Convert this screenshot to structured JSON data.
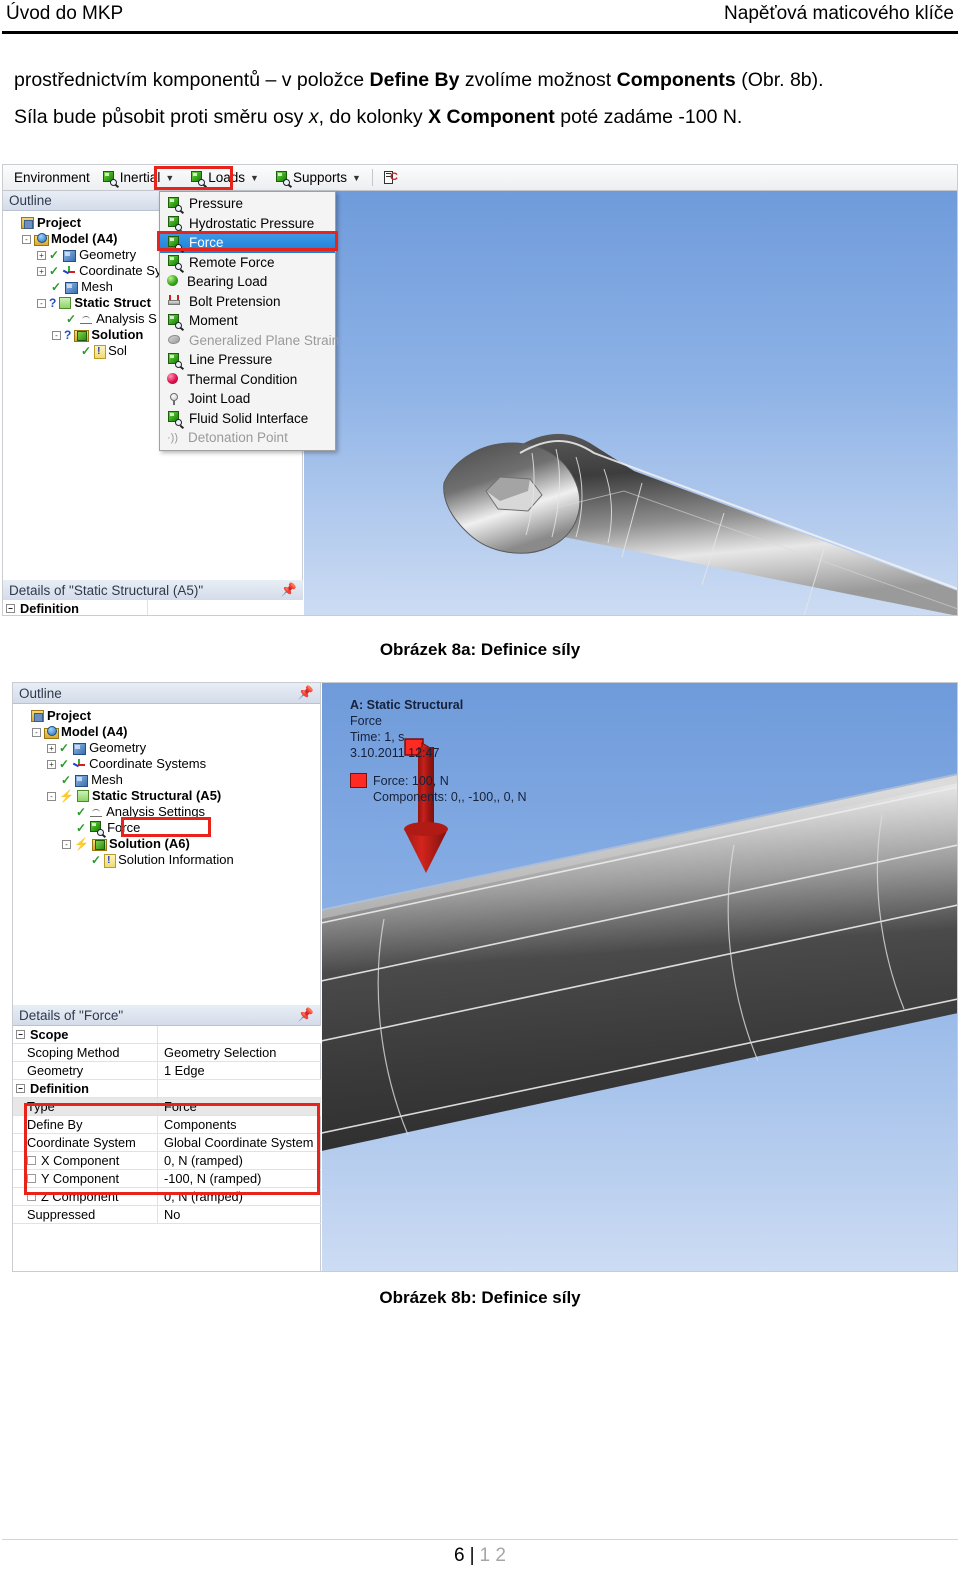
{
  "header": {
    "left": "Úvod do MKP",
    "right": "Napěťová maticového klíče"
  },
  "body": {
    "para1_a": "prostřednictvím komponentů – v položce ",
    "para1_b1": "Define By",
    "para1_c": " zvolíme možnost ",
    "para1_b2": "Components",
    "para1_d": " (Obr. 8b).",
    "para2_a": "Síla bude působit proti směru osy ",
    "para2_i": "x",
    "para2_b": ", do kolonky ",
    "para2_b1": "X Component",
    "para2_c": " poté zadáme -100 N."
  },
  "figure_a": {
    "caption": "Obrázek 8a: Definice síly",
    "toolbar": {
      "environment": "Environment",
      "inertial": "Inertial",
      "loads": "Loads",
      "supports": "Supports"
    },
    "outline_title": "Outline",
    "tree": [
      {
        "label": "Project",
        "bold": true,
        "indent": 0,
        "icon": "project-folder-icon",
        "expander": "",
        "mark": ""
      },
      {
        "label": "Model (A4)",
        "bold": true,
        "indent": 1,
        "icon": "model-icon",
        "expander": "-",
        "mark": ""
      },
      {
        "label": "Geometry",
        "bold": false,
        "indent": 2,
        "icon": "geometry-icon",
        "expander": "+",
        "mark": "check"
      },
      {
        "label": "Coordinate Sys",
        "bold": false,
        "indent": 2,
        "icon": "coordinate-system-icon",
        "expander": "+",
        "mark": "check"
      },
      {
        "label": "Mesh",
        "bold": false,
        "indent": 2,
        "icon": "mesh-icon",
        "expander": "",
        "mark": "check"
      },
      {
        "label": "Static Struct",
        "bold": true,
        "indent": 2,
        "icon": "static-structural-icon",
        "expander": "-",
        "mark": "question"
      },
      {
        "label": "Analysis S",
        "bold": false,
        "indent": 3,
        "icon": "analysis-settings-icon",
        "expander": "",
        "mark": "check"
      },
      {
        "label": "Solution",
        "bold": true,
        "indent": 3,
        "icon": "solution-icon",
        "expander": "-",
        "mark": "question"
      },
      {
        "label": "Sol",
        "bold": false,
        "indent": 4,
        "icon": "solution-information-icon",
        "expander": "",
        "mark": "check"
      }
    ],
    "menu_items": [
      {
        "label": "Pressure",
        "icon": "green-cube-icon",
        "state": "normal"
      },
      {
        "label": "Hydrostatic Pressure",
        "icon": "green-cube-icon",
        "state": "normal"
      },
      {
        "label": "Force",
        "icon": "green-cube-icon",
        "state": "selected"
      },
      {
        "label": "Remote Force",
        "icon": "green-cube-icon",
        "state": "normal"
      },
      {
        "label": "Bearing Load",
        "icon": "green-sphere-icon",
        "state": "normal"
      },
      {
        "label": "Bolt Pretension",
        "icon": "bolt-pretension-icon",
        "state": "normal"
      },
      {
        "label": "Moment",
        "icon": "green-cube-icon",
        "state": "normal"
      },
      {
        "label": "Generalized Plane Strain",
        "icon": "grey-bean-icon",
        "state": "disabled"
      },
      {
        "label": "Line Pressure",
        "icon": "green-cube-icon",
        "state": "normal"
      },
      {
        "label": "Thermal Condition",
        "icon": "red-sphere-icon",
        "state": "normal"
      },
      {
        "label": "Joint Load",
        "icon": "joint-icon",
        "state": "normal"
      },
      {
        "label": "Fluid Solid Interface",
        "icon": "green-cube-icon",
        "state": "normal"
      },
      {
        "label": "Detonation Point",
        "icon": "detonation-icon",
        "state": "disabled"
      }
    ],
    "details_title": "Details of \"Static Structural (A5)\"",
    "details_rows": [
      {
        "label": "Definition",
        "value": "",
        "header": true
      }
    ]
  },
  "figure_b": {
    "caption": "Obrázek 8b: Definice síly",
    "outline_title": "Outline",
    "tree": [
      {
        "label": "Project",
        "bold": true,
        "indent": 0,
        "icon": "project-folder-icon",
        "expander": "",
        "mark": ""
      },
      {
        "label": "Model (A4)",
        "bold": true,
        "indent": 1,
        "icon": "model-icon",
        "expander": "-",
        "mark": ""
      },
      {
        "label": "Geometry",
        "bold": false,
        "indent": 2,
        "icon": "geometry-icon",
        "expander": "+",
        "mark": "check"
      },
      {
        "label": "Coordinate Systems",
        "bold": false,
        "indent": 2,
        "icon": "coordinate-system-icon",
        "expander": "+",
        "mark": "check"
      },
      {
        "label": "Mesh",
        "bold": false,
        "indent": 2,
        "icon": "mesh-icon",
        "expander": "",
        "mark": "check"
      },
      {
        "label": "Static Structural (A5)",
        "bold": true,
        "indent": 2,
        "icon": "static-structural-icon",
        "expander": "-",
        "mark": "bolt"
      },
      {
        "label": "Analysis Settings",
        "bold": false,
        "indent": 3,
        "icon": "analysis-settings-icon",
        "expander": "",
        "mark": "check"
      },
      {
        "label": "Force",
        "bold": false,
        "indent": 3,
        "icon": "green-cube-icon",
        "expander": "",
        "mark": "check"
      },
      {
        "label": "Solution (A6)",
        "bold": true,
        "indent": 3,
        "icon": "solution-icon",
        "expander": "-",
        "mark": "bolt"
      },
      {
        "label": "Solution Information",
        "bold": false,
        "indent": 4,
        "icon": "solution-information-icon",
        "expander": "",
        "mark": "check"
      }
    ],
    "legend": {
      "line1": "A: Static Structural",
      "line2": "Force",
      "line3": "Time: 1, s",
      "line4": "3.10.2011 12:47",
      "force_label": "Force: 100, N",
      "components_label": "Components: 0,, -100,, 0, N",
      "swatch_color": "#ff2a22"
    },
    "details_title": "Details of \"Force\"",
    "details_rows": [
      {
        "label": "Scope",
        "value": "",
        "header": true,
        "check": false,
        "shade": false
      },
      {
        "label": "Scoping Method",
        "value": "Geometry Selection",
        "header": false,
        "check": false,
        "shade": false
      },
      {
        "label": "Geometry",
        "value": "1 Edge",
        "header": false,
        "check": false,
        "shade": false
      },
      {
        "label": "Definition",
        "value": "",
        "header": true,
        "check": false,
        "shade": false
      },
      {
        "label": "Type",
        "value": "Force",
        "header": false,
        "check": false,
        "shade": true
      },
      {
        "label": "Define By",
        "value": "Components",
        "header": false,
        "check": false,
        "shade": false
      },
      {
        "label": "Coordinate System",
        "value": "Global Coordinate System",
        "header": false,
        "check": false,
        "shade": false
      },
      {
        "label": "X Component",
        "value": "0, N  (ramped)",
        "header": false,
        "check": true,
        "shade": false
      },
      {
        "label": "Y Component",
        "value": "-100, N  (ramped)",
        "header": false,
        "check": true,
        "shade": false
      },
      {
        "label": "Z Component",
        "value": "0, N  (ramped)",
        "header": false,
        "check": true,
        "shade": false
      },
      {
        "label": "Suppressed",
        "value": "No",
        "header": false,
        "check": false,
        "shade": false
      }
    ]
  },
  "footer": {
    "page": "6",
    "separator": "|",
    "total": "1 2"
  },
  "colors": {
    "highlight_red": "#e8231c",
    "selection_blue": "#1f7fd6",
    "force_red": "#ff2a22"
  }
}
